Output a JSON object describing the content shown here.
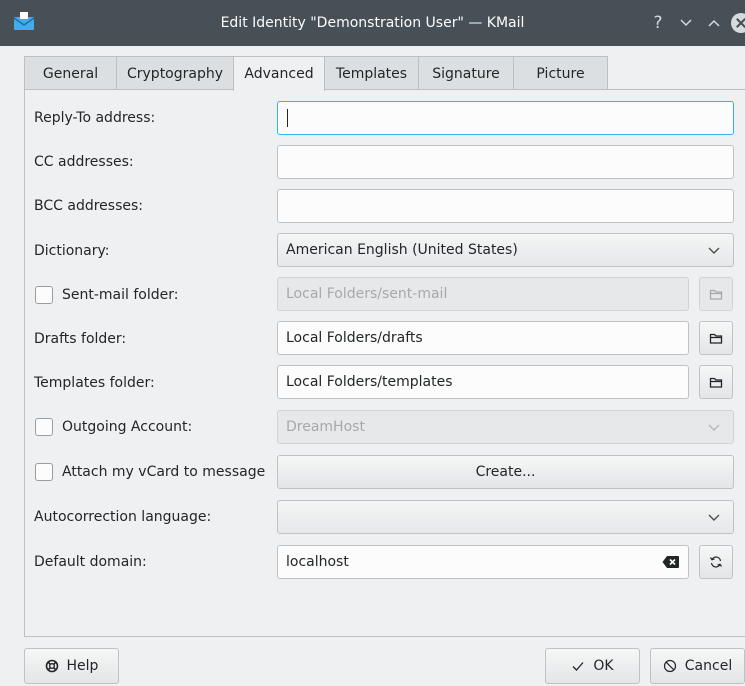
{
  "window": {
    "title": "Edit Identity \"Demonstration User\" — KMail",
    "help_glyph": "?",
    "minimize_glyph": "⌄",
    "maximize_glyph": "⌃"
  },
  "tabs": [
    {
      "label": "General",
      "active": false
    },
    {
      "label": "Cryptography",
      "active": false
    },
    {
      "label": "Advanced",
      "active": true
    },
    {
      "label": "Templates",
      "active": false
    },
    {
      "label": "Signature",
      "active": false
    },
    {
      "label": "Picture",
      "active": false
    }
  ],
  "form": {
    "reply_to": {
      "label": "Reply-To address:",
      "value": ""
    },
    "cc": {
      "label": "CC addresses:",
      "value": ""
    },
    "bcc": {
      "label": "BCC addresses:",
      "value": ""
    },
    "dictionary": {
      "label": "Dictionary:",
      "value": "American English (United States)"
    },
    "sent_mail": {
      "label": "Sent-mail folder:",
      "checked": false,
      "value": "Local Folders/sent-mail"
    },
    "drafts": {
      "label": "Drafts folder:",
      "value": "Local Folders/drafts"
    },
    "templates": {
      "label": "Templates folder:",
      "value": "Local Folders/templates"
    },
    "outgoing": {
      "label": "Outgoing Account:",
      "checked": false,
      "value": "DreamHost"
    },
    "vcard": {
      "label": "Attach my vCard to message",
      "checked": false,
      "button": "Create..."
    },
    "autocorrection": {
      "label": "Autocorrection language:",
      "value": ""
    },
    "domain": {
      "label": "Default domain:",
      "value": "localhost"
    }
  },
  "footer": {
    "help": "Help",
    "ok": "OK",
    "cancel": "Cancel"
  },
  "colors": {
    "titlebar": "#475057",
    "focus": "#3daee9",
    "window_bg": "#eff0f1"
  }
}
